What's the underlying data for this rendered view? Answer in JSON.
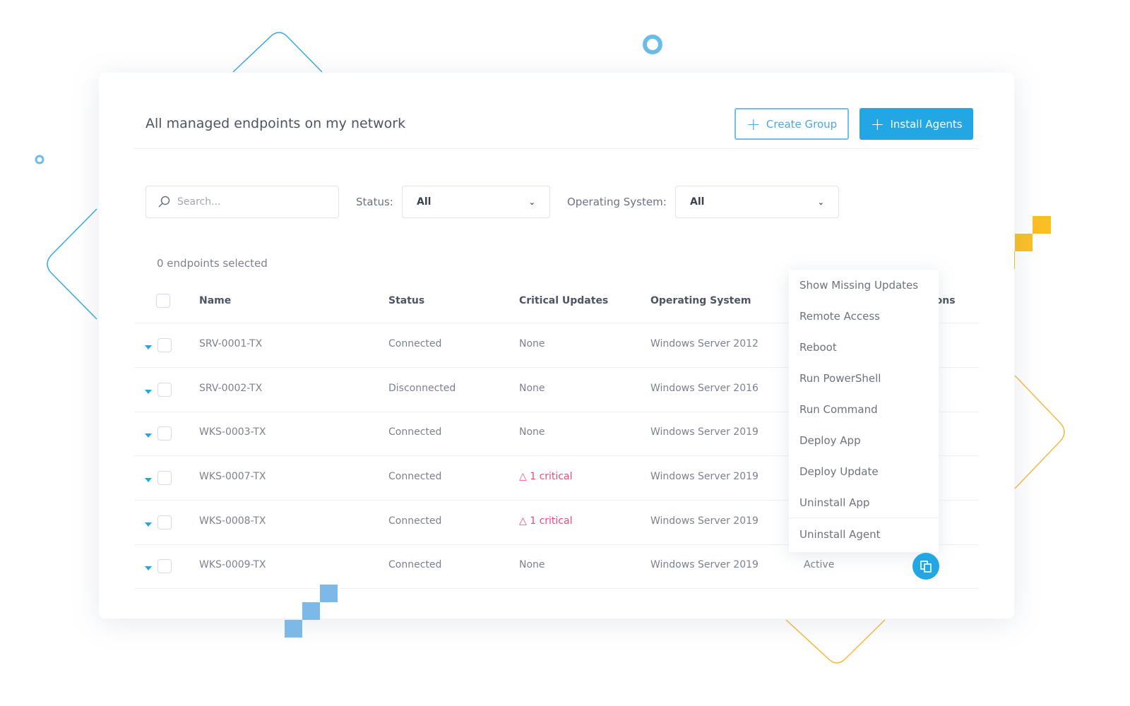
{
  "header": {
    "title": "All managed endpoints on my network",
    "create_group": "Create Group",
    "install_agents": "Install Agents"
  },
  "filters": {
    "search_placeholder": "Search...",
    "status_label": "Status:",
    "status_value": "All",
    "os_label": "Operating System:",
    "os_value": "All"
  },
  "selection": "0 endpoints selected",
  "table": {
    "columns": [
      "Name",
      "Status",
      "Critical Updates",
      "Operating System",
      "Actions"
    ],
    "rows": [
      {
        "name": "SRV-0001-TX",
        "status": "Connected",
        "critical": "None",
        "os": "Windows Server 2012",
        "critical_flag": false
      },
      {
        "name": "SRV-0002-TX",
        "status": "Disconnected",
        "critical": "None",
        "os": "Windows Server 2016",
        "critical_flag": false
      },
      {
        "name": "WKS-0003-TX",
        "status": "Connected",
        "critical": "None",
        "os": "Windows Server 2019",
        "critical_flag": false
      },
      {
        "name": "WKS-0007-TX",
        "status": "Connected",
        "critical": "1 critical",
        "os": "Windows Server 2019",
        "critical_flag": true
      },
      {
        "name": "WKS-0008-TX",
        "status": "Connected",
        "critical": "1 critical",
        "os": "Windows Server 2019",
        "critical_flag": true
      },
      {
        "name": "WKS-0009-TX",
        "status": "Connected",
        "critical": "None",
        "os": "Windows Server 2019",
        "critical_flag": false,
        "agent": "Active"
      }
    ]
  },
  "menu": [
    "Show Missing Updates",
    "Remote Access",
    "Reboot",
    "Run PowerShell",
    "Run Command",
    "Deploy App",
    "Deploy Update",
    "Uninstall App",
    "Uninstall Agent"
  ],
  "colors": {
    "accent": "#22a6e4",
    "critical": "#f0477a",
    "yellow": "#fbbf24",
    "blue_squares": "#7db9e8"
  }
}
